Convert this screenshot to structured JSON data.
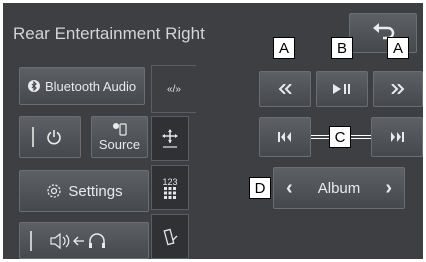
{
  "header": {
    "title": "Rear Entertainment Right"
  },
  "sidebar": {
    "bluetooth_audio": "Bluetooth Audio",
    "source": "Source",
    "settings": "Settings"
  },
  "tabs": {
    "tab1_label": "«/»",
    "tab3_label": "123"
  },
  "controls": {
    "album_label": "Album"
  },
  "callouts": {
    "a1": "A",
    "b": "B",
    "a2": "A",
    "c": "C",
    "d": "D"
  }
}
